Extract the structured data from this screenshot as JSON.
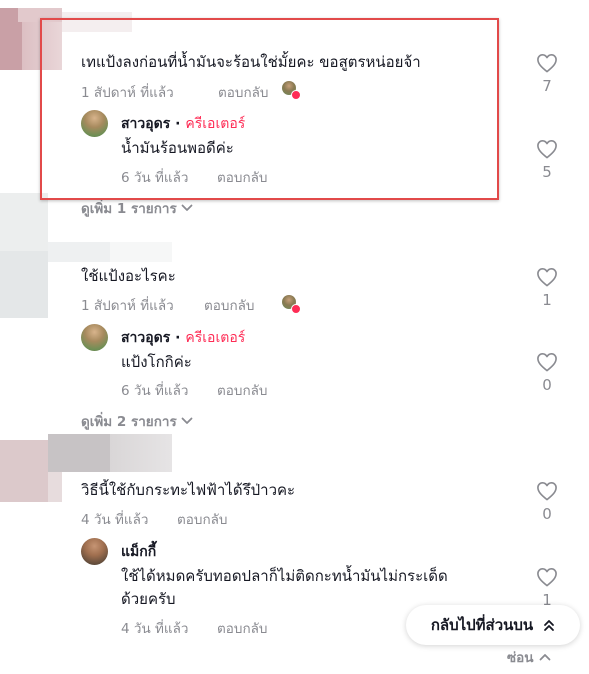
{
  "threads": [
    {
      "comment": {
        "text": "เทแป้งลงก่อนที่น้ำมันจะร้อนใช่มั้ยคะ ขอสูตรหน่อยจ้า",
        "time": "1 สัปดาห์ ที่แล้ว",
        "reply_label": "ตอบกลับ",
        "likes": "7"
      },
      "reply": {
        "name": "สาวอุดร",
        "separator": "·",
        "badge": "ครีเอเตอร์",
        "text": "น้ำมันร้อนพอดีค่ะ",
        "time": "6 วัน ที่แล้ว",
        "reply_label": "ตอบกลับ",
        "likes": "5"
      },
      "more_label": "ดูเพิ่ม 1 รายการ"
    },
    {
      "comment": {
        "text": "ใช้แป้งอะไรคะ",
        "time": "1 สัปดาห์ ที่แล้ว",
        "reply_label": "ตอบกลับ",
        "likes": "1"
      },
      "reply": {
        "name": "สาวอุดร",
        "separator": "·",
        "badge": "ครีเอเตอร์",
        "text": "แป้งโกกิค่ะ",
        "time": "6 วัน ที่แล้ว",
        "reply_label": "ตอบกลับ",
        "likes": "0"
      },
      "more_label": "ดูเพิ่ม 2 รายการ"
    },
    {
      "comment": {
        "text": "วิธีนี้ใช้กับกระทะไฟฟ้าได้รึป่าวคะ",
        "time": "4 วัน ที่แล้ว",
        "reply_label": "ตอบกลับ",
        "likes": "0"
      },
      "reply": {
        "name": "แม็กกี้",
        "text_line1": "ใช้ได้หมดครับทอดปลาก็ไม่ติดกะทน้ำมันไม่กระเด็ด",
        "text_line2": "ด้วยครับ",
        "time": "4 วัน ที่แล้ว",
        "reply_label": "ตอบกลับ",
        "likes": "1"
      }
    }
  ],
  "back_to_top_label": "กลับไปที่ส่วนบน",
  "hide_label": "ซ่อน",
  "colors": {
    "highlight": "#e24a4a",
    "creator": "#fe2c55",
    "muted": "#8a8b91",
    "text": "#161823"
  },
  "icons": [
    "heart-outline-icon",
    "chevron-down-icon",
    "chevron-up-icon",
    "double-chevron-up-icon"
  ]
}
